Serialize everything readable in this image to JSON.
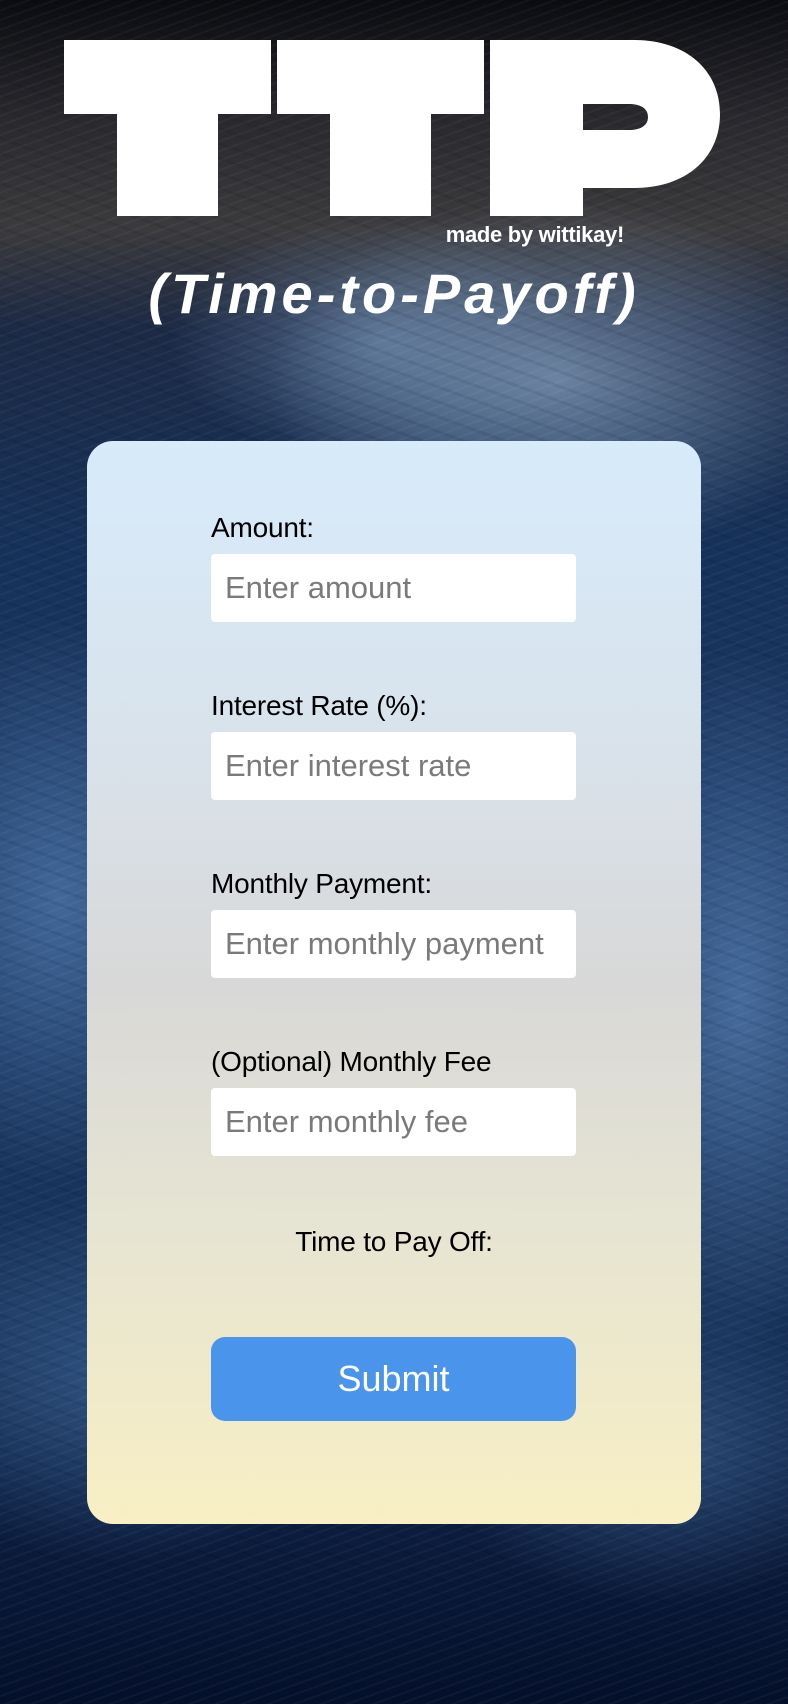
{
  "header": {
    "logo_text": "TTP",
    "made_by": "made by wittikay!",
    "subtitle": "(Time-to-Payoff)"
  },
  "form": {
    "amount": {
      "label": "Amount:",
      "placeholder": "Enter amount",
      "value": ""
    },
    "interest_rate": {
      "label": "Interest Rate (%):",
      "placeholder": "Enter interest rate",
      "value": ""
    },
    "monthly_payment": {
      "label": "Monthly Payment:",
      "placeholder": "Enter monthly payment",
      "value": ""
    },
    "monthly_fee": {
      "label": "(Optional) Monthly Fee",
      "placeholder": "Enter monthly fee",
      "value": ""
    },
    "result_label": "Time to Pay Off:",
    "submit_label": "Submit"
  },
  "colors": {
    "submit_button": "#4a94eb",
    "card_top": "#d7ebfb",
    "card_bottom": "#f8efc4",
    "logo": "#ffffff"
  }
}
